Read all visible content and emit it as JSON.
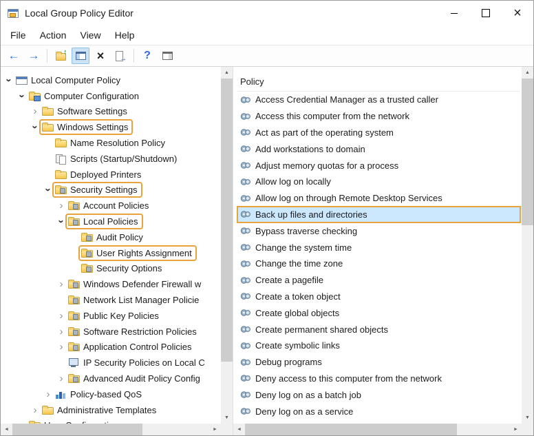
{
  "window": {
    "title": "Local Group Policy Editor",
    "controls": [
      {
        "name": "minimize"
      },
      {
        "name": "maximize"
      },
      {
        "name": "close"
      }
    ]
  },
  "menu": {
    "items": [
      "File",
      "Action",
      "View",
      "Help"
    ]
  },
  "toolbar": {
    "buttons": [
      {
        "name": "back-arrow"
      },
      {
        "name": "forward-arrow"
      },
      {
        "name": "separator"
      },
      {
        "name": "up-one-level"
      },
      {
        "name": "show-console-tree",
        "pressed": true
      },
      {
        "name": "delete"
      },
      {
        "name": "export-list"
      },
      {
        "name": "separator"
      },
      {
        "name": "help"
      },
      {
        "name": "action-pane"
      }
    ]
  },
  "tree": {
    "items": [
      {
        "label": "Local Computer Policy",
        "level": 0,
        "chevron": "expanded",
        "icon": "console-root"
      },
      {
        "label": "Computer Configuration",
        "level": 1,
        "chevron": "expanded",
        "icon": "computer-config"
      },
      {
        "label": "Software Settings",
        "level": 2,
        "chevron": "collapsed",
        "icon": "folder"
      },
      {
        "label": "Windows Settings",
        "level": 2,
        "chevron": "expanded",
        "icon": "folder",
        "annotated": true
      },
      {
        "label": "Name Resolution Policy",
        "level": 3,
        "chevron": "none",
        "icon": "folder"
      },
      {
        "label": "Scripts (Startup/Shutdown)",
        "level": 3,
        "chevron": "none",
        "icon": "scripts"
      },
      {
        "label": "Deployed Printers",
        "level": 3,
        "chevron": "none",
        "icon": "printer"
      },
      {
        "label": "Security Settings",
        "level": 3,
        "chevron": "expanded",
        "icon": "folder-lock",
        "annotated": true
      },
      {
        "label": "Account Policies",
        "level": 4,
        "chevron": "collapsed",
        "icon": "folder-lock"
      },
      {
        "label": "Local Policies",
        "level": 4,
        "chevron": "expanded",
        "icon": "folder-lock",
        "annotated": true
      },
      {
        "label": "Audit Policy",
        "level": 5,
        "chevron": "none",
        "icon": "folder-lock"
      },
      {
        "label": "User Rights Assignment",
        "level": 5,
        "chevron": "none",
        "icon": "folder-lock",
        "annotated": true
      },
      {
        "label": "Security Options",
        "level": 5,
        "chevron": "none",
        "icon": "folder-lock"
      },
      {
        "label": "Windows Defender Firewall w",
        "level": 4,
        "chevron": "collapsed",
        "icon": "folder-lock"
      },
      {
        "label": "Network List Manager Policie",
        "level": 4,
        "chevron": "none",
        "icon": "folder-lock"
      },
      {
        "label": "Public Key Policies",
        "level": 4,
        "chevron": "collapsed",
        "icon": "folder-lock"
      },
      {
        "label": "Software Restriction Policies",
        "level": 4,
        "chevron": "collapsed",
        "icon": "folder-lock"
      },
      {
        "label": "Application Control Policies",
        "level": 4,
        "chevron": "collapsed",
        "icon": "folder-lock"
      },
      {
        "label": "IP Security Policies on Local C",
        "level": 4,
        "chevron": "none",
        "icon": "ipsec"
      },
      {
        "label": "Advanced Audit Policy Config",
        "level": 4,
        "chevron": "collapsed",
        "icon": "folder-lock"
      },
      {
        "label": "Policy-based QoS",
        "level": 3,
        "chevron": "collapsed",
        "icon": "qos"
      },
      {
        "label": "Administrative Templates",
        "level": 2,
        "chevron": "collapsed",
        "icon": "folder"
      },
      {
        "label": "User Configuration",
        "level": 1,
        "chevron": "collapsed",
        "icon": "computer-config"
      }
    ]
  },
  "list": {
    "header": "Policy",
    "items": [
      {
        "label": "Access Credential Manager as a trusted caller"
      },
      {
        "label": "Access this computer from the network"
      },
      {
        "label": "Act as part of the operating system"
      },
      {
        "label": "Add workstations to domain"
      },
      {
        "label": "Adjust memory quotas for a process"
      },
      {
        "label": "Allow log on locally"
      },
      {
        "label": "Allow log on through Remote Desktop Services"
      },
      {
        "label": "Back up files and directories",
        "selected": true,
        "annotated": true
      },
      {
        "label": "Bypass traverse checking"
      },
      {
        "label": "Change the system time"
      },
      {
        "label": "Change the time zone"
      },
      {
        "label": "Create a pagefile"
      },
      {
        "label": "Create a token object"
      },
      {
        "label": "Create global objects"
      },
      {
        "label": "Create permanent shared objects"
      },
      {
        "label": "Create symbolic links"
      },
      {
        "label": "Debug programs"
      },
      {
        "label": "Deny access to this computer from the network"
      },
      {
        "label": "Deny log on as a batch job"
      },
      {
        "label": "Deny log on as a service"
      }
    ]
  },
  "colors": {
    "annotation": "#E8A33D",
    "selection_bg": "#CCE8FF",
    "selection_border": "#84C3F0",
    "arrow": "#2E6BD6"
  }
}
